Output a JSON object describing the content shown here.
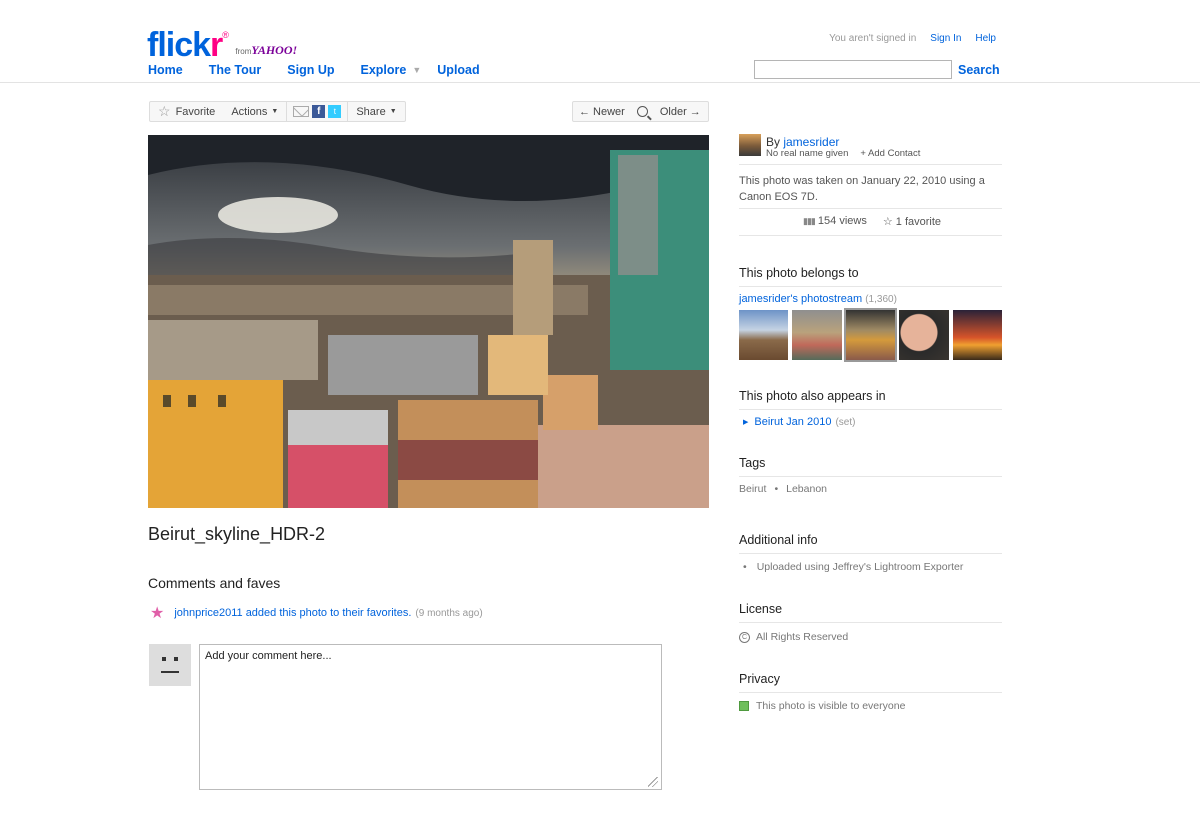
{
  "header": {
    "logo_flick": "flick",
    "logo_r": "r",
    "logo_reg": "®",
    "logo_from": "from",
    "logo_yahoo": "YAHOO!",
    "nav": [
      {
        "label": "Home"
      },
      {
        "label": "The Tour"
      },
      {
        "label": "Sign Up"
      },
      {
        "label": "Explore"
      },
      {
        "label": "Upload"
      }
    ],
    "signed_status": "You aren't signed in",
    "sign_in": "Sign In",
    "help": "Help",
    "search_label": "Search",
    "search_value": ""
  },
  "toolbar": {
    "favorite": "Favorite",
    "actions": "Actions",
    "share": "Share",
    "newer": "← Newer",
    "older": "Older →"
  },
  "photo": {
    "title": "Beirut_skyline_HDR-2"
  },
  "comments": {
    "heading": "Comments and faves",
    "fave_text": "johnprice2011 added this photo to their favorites.",
    "fave_ago": "(9 months ago)",
    "placeholder": "Add your comment here..."
  },
  "sidebar": {
    "by_prefix": "By ",
    "owner": "jamesrider",
    "real_name": "No real name given",
    "add_contact": "+ Add Contact",
    "taken": "This photo was taken on January 22, 2010 using a Canon EOS 7D.",
    "views": "154 views",
    "favorites": "1 favorite",
    "belongs_heading": "This photo belongs to",
    "stream_link": "jamesrider's photostream",
    "stream_count": "(1,360)",
    "appears_heading": "This photo also appears in",
    "set_link": "Beirut Jan 2010",
    "set_meta": "(set)",
    "tags_heading": "Tags",
    "tags": [
      "Beirut",
      "Lebanon"
    ],
    "tag_sep": "•",
    "additional_heading": "Additional info",
    "additional_item": "Uploaded using Jeffrey's Lightroom Exporter",
    "license_heading": "License",
    "license": "All Rights Reserved",
    "privacy_heading": "Privacy",
    "privacy": "This photo is visible to everyone"
  },
  "colors": {
    "link": "#0063dc",
    "pink": "#ff0084"
  }
}
